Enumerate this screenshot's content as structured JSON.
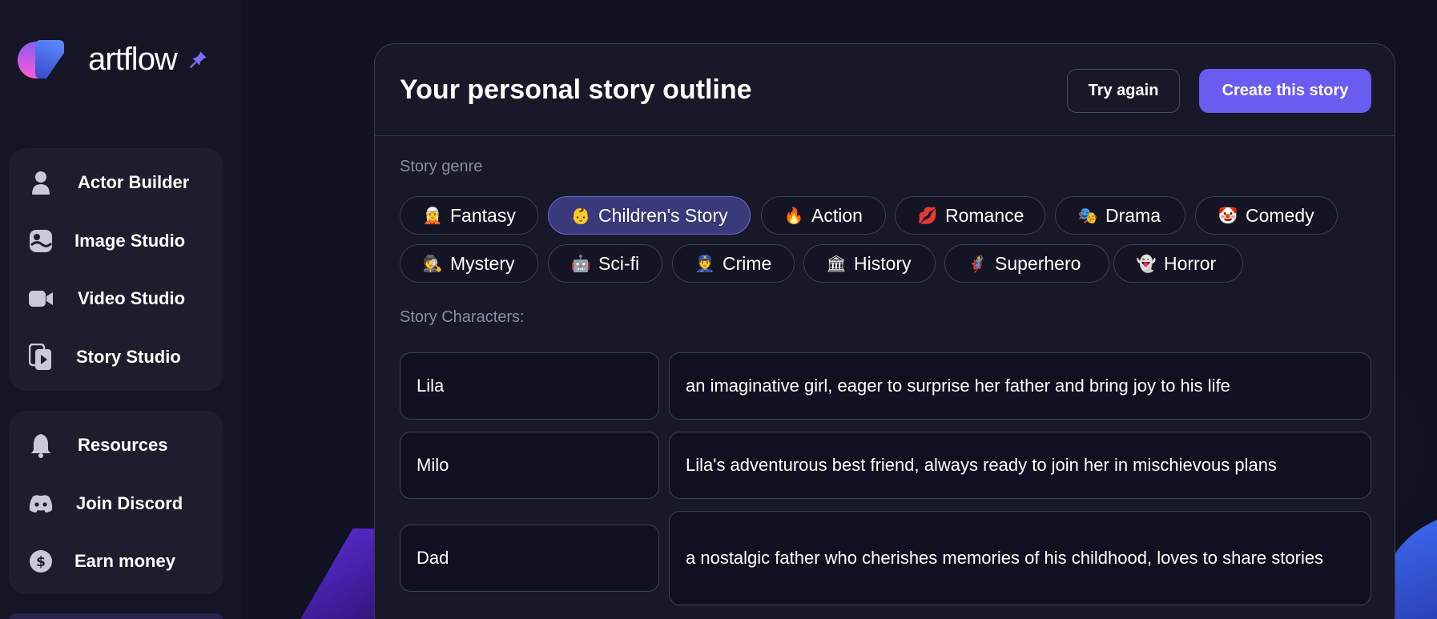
{
  "brand": {
    "name_part1": "art",
    "name_part2": "flow"
  },
  "sidebar": {
    "group1": [
      {
        "label": "Actor Builder",
        "icon": "person-icon"
      },
      {
        "label": "Image Studio",
        "icon": "image-icon"
      },
      {
        "label": "Video Studio",
        "icon": "video-camera-icon"
      },
      {
        "label": "Story Studio",
        "icon": "story-play-icon"
      }
    ],
    "group2": [
      {
        "label": "Resources",
        "icon": "bell-icon"
      },
      {
        "label": "Join Discord",
        "icon": "discord-icon"
      },
      {
        "label": "Earn money",
        "icon": "dollar-icon"
      }
    ]
  },
  "header": {
    "title": "Your personal story outline",
    "try_again": "Try again",
    "create": "Create this story"
  },
  "genre": {
    "label": "Story genre",
    "selected": "Children's Story",
    "chips": [
      {
        "emoji": "🧝",
        "label": "Fantasy"
      },
      {
        "emoji": "👶",
        "label": "Children's Story"
      },
      {
        "emoji": "🔥",
        "label": "Action"
      },
      {
        "emoji": "💋",
        "label": "Romance"
      },
      {
        "emoji": "🎭",
        "label": "Drama"
      },
      {
        "emoji": "🤡",
        "label": "Comedy"
      },
      {
        "emoji": "🕵",
        "label": "Mystery"
      },
      {
        "emoji": "🤖",
        "label": "Sci-fi"
      },
      {
        "emoji": "👮",
        "label": "Crime"
      },
      {
        "emoji": "🏛",
        "label": "History"
      },
      {
        "emoji": "🦸",
        "label": "Superhero"
      },
      {
        "emoji": "👻",
        "label": "Horror"
      }
    ]
  },
  "characters": {
    "label": "Story Characters:",
    "rows": [
      {
        "name": "Lila",
        "description": "an imaginative girl, eager to surprise her father and bring joy to his life"
      },
      {
        "name": "Milo",
        "description": "Lila's adventurous best friend, always ready to join her in mischievous plans"
      },
      {
        "name": "Dad",
        "description": "a nostalgic father who cherishes memories of his childhood, loves to share stories"
      }
    ]
  },
  "colors": {
    "accent": "#6a5cf0",
    "background": "#111221",
    "selected_chip": "#3a3979"
  }
}
